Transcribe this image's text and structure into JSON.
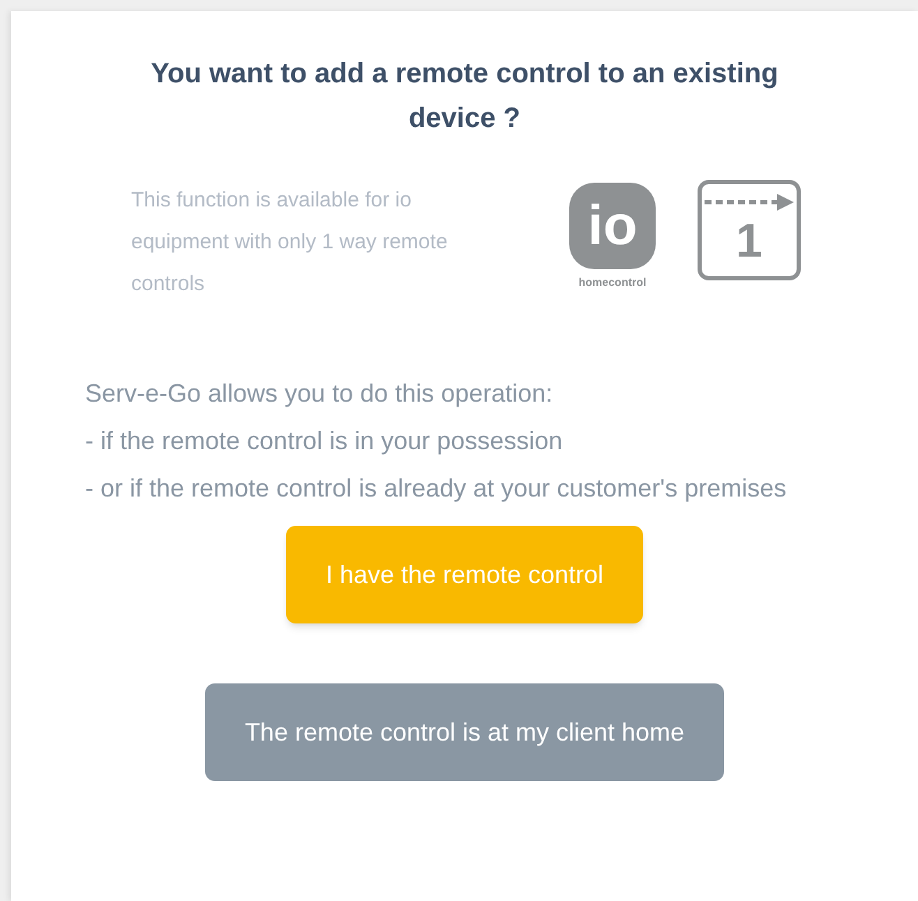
{
  "title": "You want to add a remote control to an existing device ?",
  "info": {
    "text": "This function is available for io equipment with only 1 way remote controls",
    "logo_mark": "io",
    "logo_caption": "homecontrol",
    "one_way_icon_label": "1"
  },
  "description": [
    "Serv-e-Go allows you to do this operation:",
    "- if the remote control is in your possession",
    "- or if the remote control is already at your customer's premises"
  ],
  "buttons": [
    {
      "label": "I have the remote control",
      "kind": "primary"
    },
    {
      "label": "The remote control is at my client home",
      "kind": "secondary"
    }
  ]
}
